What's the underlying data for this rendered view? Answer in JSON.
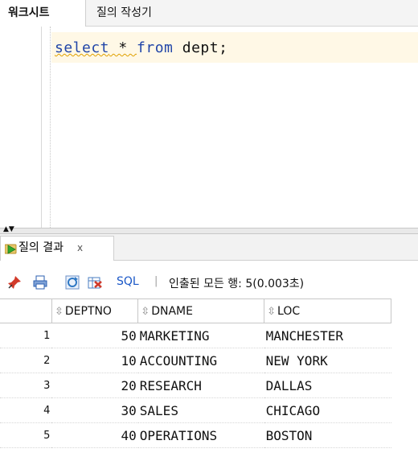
{
  "tabs": [
    {
      "label": "워크시트"
    },
    {
      "label": "질의 작성기"
    }
  ],
  "editor": {
    "sql_keyword_select": "select",
    "sql_star": " * ",
    "sql_keyword_from": "from",
    "sql_rest": " dept;"
  },
  "results": {
    "tab_label": "질의 결과",
    "tab_close": "x",
    "toolbar": {
      "sql_label": "SQL",
      "separator": "|",
      "status": "인출된 모든 행: 5(0.003초)"
    },
    "columns": [
      "DEPTNO",
      "DNAME",
      "LOC"
    ],
    "rows": [
      {
        "n": "1",
        "deptno": "50",
        "dname": "MARKETING",
        "loc": "MANCHESTER"
      },
      {
        "n": "2",
        "deptno": "10",
        "dname": "ACCOUNTING",
        "loc": "NEW YORK"
      },
      {
        "n": "3",
        "deptno": "20",
        "dname": "RESEARCH",
        "loc": "DALLAS"
      },
      {
        "n": "4",
        "deptno": "30",
        "dname": "SALES",
        "loc": "CHICAGO"
      },
      {
        "n": "5",
        "deptno": "40",
        "dname": "OPERATIONS",
        "loc": "BOSTON"
      }
    ]
  },
  "colors": {
    "keyword": "#2145a8",
    "sql_link": "#1a57c7",
    "current_line": "#fff8e6"
  },
  "icons": [
    "pin-icon",
    "print-icon",
    "refresh-icon",
    "export-icon",
    "run-query-icon",
    "sort-icon",
    "splitter-arrows-icon"
  ]
}
